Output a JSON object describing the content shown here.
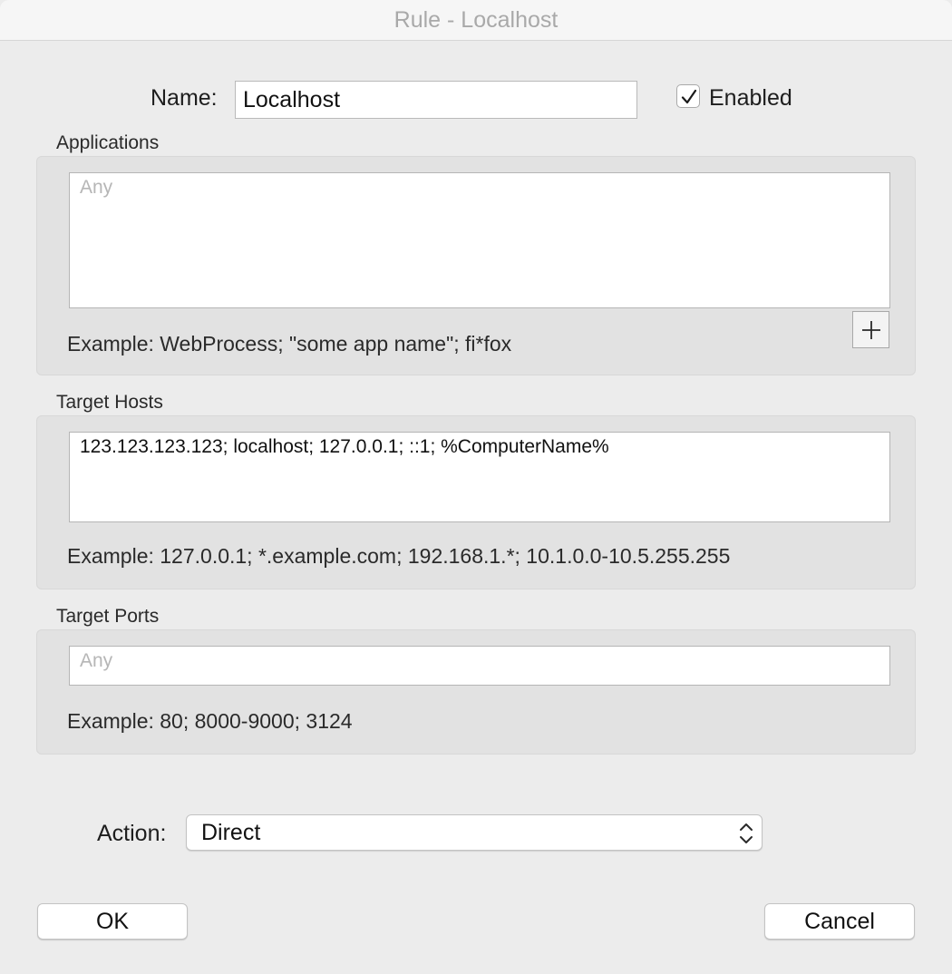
{
  "window": {
    "title": "Rule - Localhost"
  },
  "name_row": {
    "label": "Name:",
    "value": "Localhost",
    "enabled_label": "Enabled",
    "enabled_checked": true
  },
  "applications": {
    "section_label": "Applications",
    "placeholder": "Any",
    "example": "Example: WebProcess; \"some app name\"; fi*fox",
    "add_icon": "plus-icon"
  },
  "target_hosts": {
    "section_label": "Target Hosts",
    "value": "123.123.123.123; localhost; 127.0.0.1; ::1; %ComputerName%",
    "example": "Example: 127.0.0.1; *.example.com; 192.168.1.*; 10.1.0.0-10.5.255.255"
  },
  "target_ports": {
    "section_label": "Target Ports",
    "placeholder": "Any",
    "example": "Example: 80; 8000-9000; 3124"
  },
  "action": {
    "label": "Action:",
    "selected": "Direct",
    "icon": "up-down-chevron-icon"
  },
  "buttons": {
    "ok": "OK",
    "cancel": "Cancel"
  }
}
